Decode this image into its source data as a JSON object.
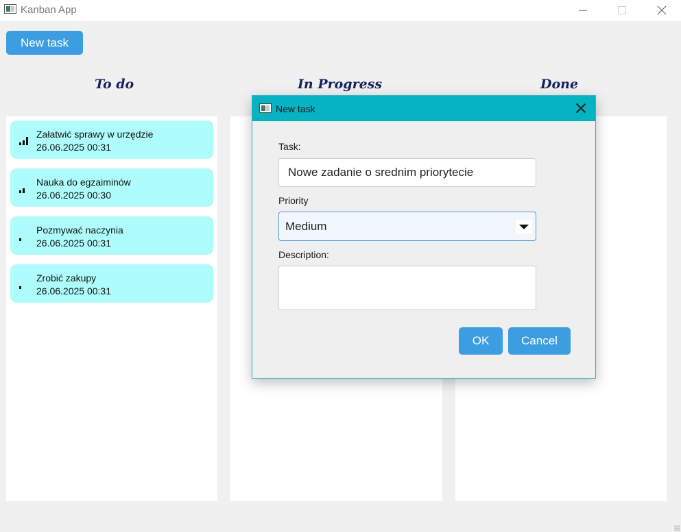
{
  "window": {
    "title": "Kanban App"
  },
  "toolbar": {
    "new_task_label": "New task"
  },
  "columns": [
    {
      "title": "To do"
    },
    {
      "title": "In Progress"
    },
    {
      "title": "Done"
    }
  ],
  "todo_tasks": [
    {
      "title": "Załatwić sprawy w urzędzie",
      "date": "26.06.2025 00:31",
      "priority_icon": "priority-high-icon"
    },
    {
      "title": "Nauka do egzaiminów",
      "date": "26.06.2025 00:30",
      "priority_icon": "priority-medium-icon"
    },
    {
      "title": "Pozmywać naczynia",
      "date": "26.06.2025 00:31",
      "priority_icon": "priority-low-icon"
    },
    {
      "title": "Zrobić zakupy",
      "date": "26.06.2025 00:31",
      "priority_icon": "priority-low-icon"
    }
  ],
  "dialog": {
    "title": "New task",
    "task_label": "Task:",
    "task_value": "Nowe zadanie o  srednim priorytecie",
    "priority_label": "Priority",
    "priority_value": "Medium",
    "description_label": "Description:",
    "description_value": "",
    "ok_label": "OK",
    "cancel_label": "Cancel"
  },
  "colors": {
    "accent": "#3c9ee0",
    "dialog_titlebar": "#05b3c3",
    "card_background": "#aefcfc",
    "column_header": "#14215e"
  }
}
